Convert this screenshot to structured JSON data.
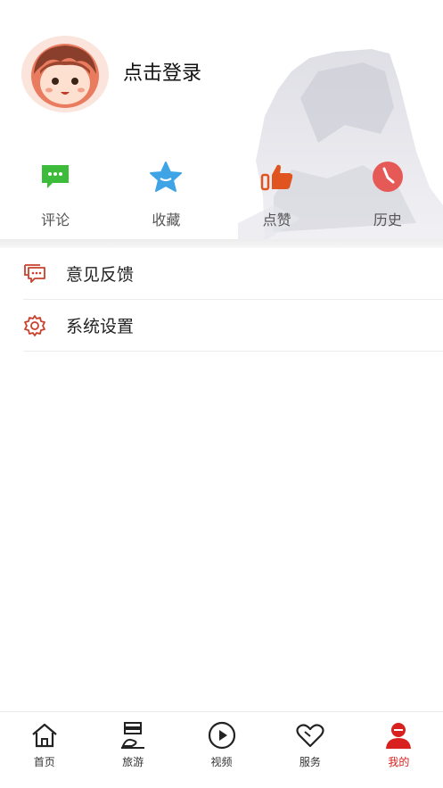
{
  "header": {
    "login_label": "点击登录"
  },
  "quick_actions": [
    {
      "label": "评论",
      "icon": "comment-icon",
      "color": "#3dbb3a"
    },
    {
      "label": "收藏",
      "icon": "star-icon",
      "color": "#3fa4e6"
    },
    {
      "label": "点赞",
      "icon": "thumbs-up-icon",
      "color": "#e0541f"
    },
    {
      "label": "历史",
      "icon": "clock-icon",
      "color": "#e55a57"
    }
  ],
  "menu": [
    {
      "label": "意见反馈",
      "icon": "feedback-icon"
    },
    {
      "label": "系统设置",
      "icon": "settings-gear-icon"
    }
  ],
  "tabbar": {
    "items": [
      {
        "label": "首页",
        "icon": "home-icon"
      },
      {
        "label": "旅游",
        "icon": "travel-icon"
      },
      {
        "label": "视频",
        "icon": "play-icon"
      },
      {
        "label": "服务",
        "icon": "heart-icon"
      },
      {
        "label": "我的",
        "icon": "user-icon"
      }
    ],
    "active": "我的",
    "active_color": "#d8201e"
  }
}
